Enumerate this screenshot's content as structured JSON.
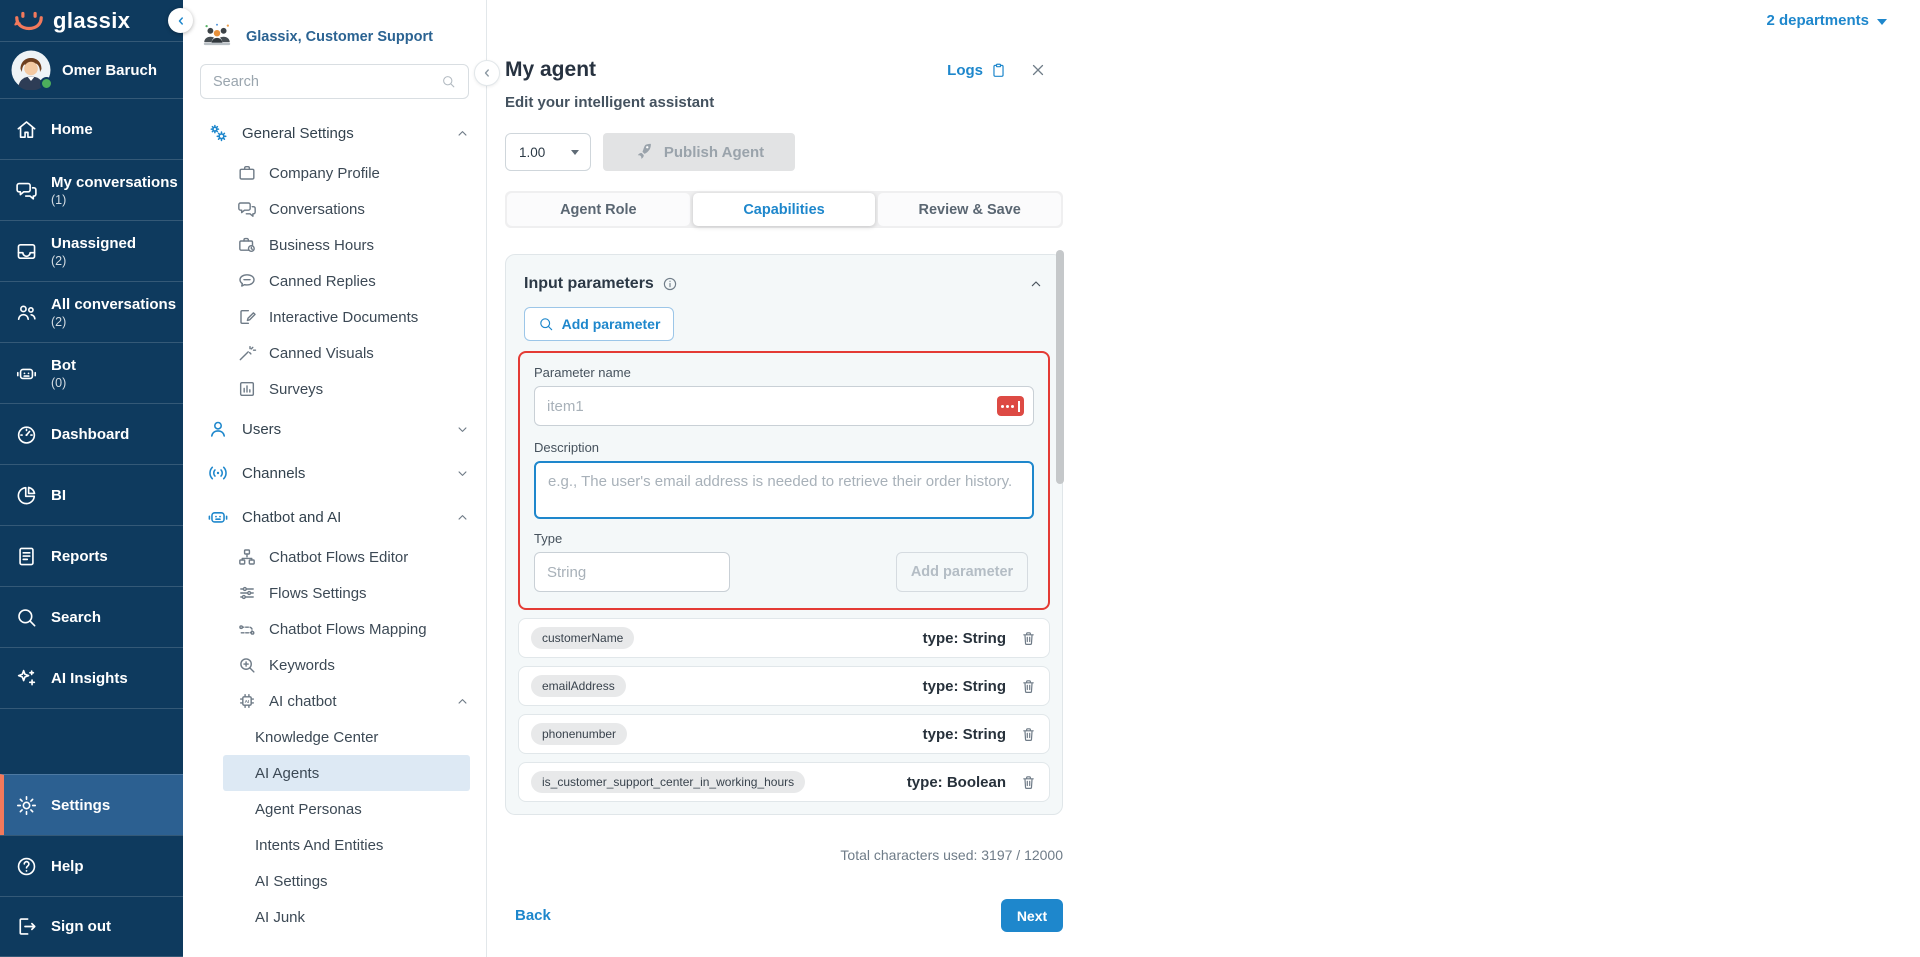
{
  "colors": {
    "accent_blue": "#1e87cc",
    "alert_red": "#e43b35",
    "brand_coral": "#f2795c",
    "sidebar_navy": "#0e3a5e",
    "active_row_blue": "#dde9f4"
  },
  "brand": {
    "logo_text": "glassix"
  },
  "topbar": {
    "departments_label": "2 departments"
  },
  "sidebar": {
    "user": {
      "name": "Omer Baruch"
    },
    "items": [
      {
        "label": "Home",
        "icon": "home"
      },
      {
        "label": "My conversations",
        "count": "(1)",
        "icon": "chat"
      },
      {
        "label": "Unassigned",
        "count": "(2)",
        "icon": "inbox"
      },
      {
        "label": "All conversations",
        "count": "(2)",
        "icon": "people"
      },
      {
        "label": "Bot",
        "count": "(0)",
        "icon": "bot"
      },
      {
        "label": "Dashboard",
        "icon": "gauge"
      },
      {
        "label": "BI",
        "icon": "pie"
      },
      {
        "label": "Reports",
        "icon": "report"
      },
      {
        "label": "Search",
        "icon": "search"
      },
      {
        "label": "AI Insights",
        "icon": "sparkles"
      }
    ],
    "bottom_items": [
      {
        "label": "Settings",
        "icon": "gear",
        "active": true
      },
      {
        "label": "Help",
        "icon": "help"
      },
      {
        "label": "Sign out",
        "icon": "signout"
      }
    ]
  },
  "settings_nav": {
    "team_label": "Glassix, Customer Support",
    "search_placeholder": "Search",
    "items": [
      {
        "label": "General Settings",
        "icon": "gears",
        "level": 0,
        "chevron": "up"
      },
      {
        "label": "Company Profile",
        "icon": "briefcase",
        "level": 1
      },
      {
        "label": "Conversations",
        "icon": "chat",
        "level": 1
      },
      {
        "label": "Business Hours",
        "icon": "briefcase-clock",
        "level": 1
      },
      {
        "label": "Canned Replies",
        "icon": "speech",
        "level": 1
      },
      {
        "label": "Interactive Documents",
        "icon": "doc-edit",
        "level": 1
      },
      {
        "label": "Canned Visuals",
        "icon": "wand",
        "level": 1
      },
      {
        "label": "Surveys",
        "icon": "chart",
        "level": 1
      },
      {
        "label": "Users",
        "icon": "user",
        "level": 0,
        "chevron": "down"
      },
      {
        "label": "Channels",
        "icon": "broadcast",
        "level": 0,
        "chevron": "down"
      },
      {
        "label": "Chatbot and AI",
        "icon": "robot",
        "level": 0,
        "chevron": "up"
      },
      {
        "label": "Chatbot Flows Editor",
        "icon": "flow",
        "level": 1
      },
      {
        "label": "Flows Settings",
        "icon": "sliders",
        "level": 1
      },
      {
        "label": "Chatbot Flows Mapping",
        "icon": "mapping",
        "level": 1
      },
      {
        "label": "Keywords",
        "icon": "zoom-plus",
        "level": 1
      },
      {
        "label": "AI chatbot",
        "icon": "chip",
        "level": 1,
        "chevron": "up"
      },
      {
        "label": "Knowledge Center",
        "level": 2
      },
      {
        "label": "AI Agents",
        "level": 2,
        "active": true
      },
      {
        "label": "Agent Personas",
        "level": 2
      },
      {
        "label": "Intents And Entities",
        "level": 2
      },
      {
        "label": "AI Settings",
        "level": 2
      },
      {
        "label": "AI Junk",
        "level": 2
      }
    ]
  },
  "panel": {
    "title": "My agent",
    "subtitle": "Edit your intelligent assistant",
    "logs_label": "Logs",
    "version": "1.00",
    "publish_label": "Publish Agent",
    "tabs": [
      {
        "label": "Agent Role"
      },
      {
        "label": "Capabilities",
        "active": true
      },
      {
        "label": "Review & Save"
      }
    ],
    "input_parameters": {
      "title": "Input parameters",
      "add_button": "Add parameter",
      "form": {
        "name_label": "Parameter name",
        "name_placeholder": "item1",
        "description_label": "Description",
        "description_placeholder": "e.g., The user's email address is needed to retrieve their order history.",
        "type_label": "Type",
        "type_value": "String",
        "submit_label": "Add parameter"
      },
      "parameters": [
        {
          "name": "customerName",
          "type_text": "type: String"
        },
        {
          "name": "emailAddress",
          "type_text": "type: String"
        },
        {
          "name": "phonenumber",
          "type_text": "type: String"
        },
        {
          "name": "is_customer_support_center_in_working_hours",
          "type_text": "type: Boolean"
        }
      ]
    },
    "chars_used": "Total characters used: 3197 / 12000",
    "back_label": "Back",
    "next_label": "Next"
  }
}
